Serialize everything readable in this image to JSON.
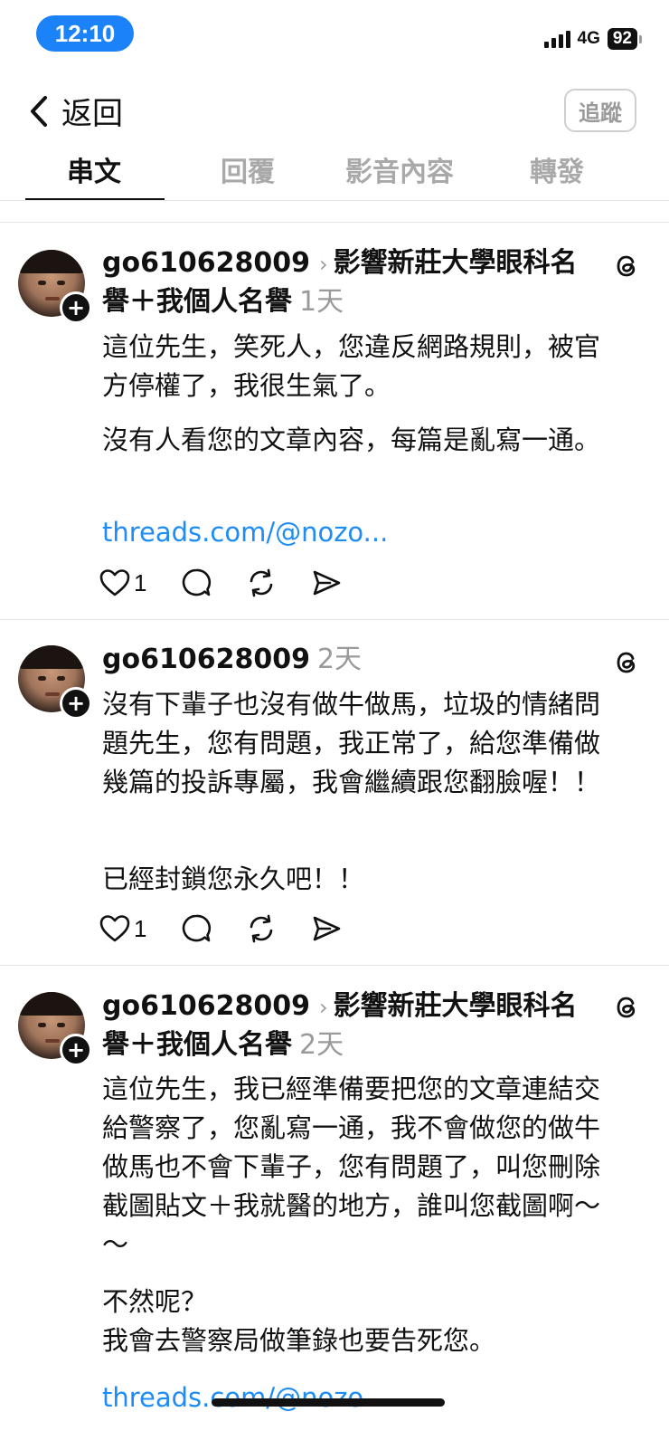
{
  "status_bar": {
    "time": "12:10",
    "network": "4G",
    "battery": "92"
  },
  "header": {
    "back_label": "返回",
    "follow_label": "追蹤"
  },
  "tabs": [
    {
      "label": "串文",
      "active": true
    },
    {
      "label": "回覆",
      "active": false
    },
    {
      "label": "影音內容",
      "active": false
    },
    {
      "label": "轉發",
      "active": false
    }
  ],
  "posts": [
    {
      "username": "go610628009",
      "topic": "影響新莊大學眼科名譽＋我個人名譽",
      "time": "1天",
      "paragraphs": [
        "這位先生，笑死人，您違反網路規則，被官方停權了，我很生氣了。",
        "沒有人看您的文章內容，每篇是亂寫一通。"
      ],
      "link": "threads.com/@nozo...",
      "likes": "1"
    },
    {
      "username": "go610628009",
      "topic": "",
      "time": "2天",
      "paragraphs": [
        "沒有下輩子也沒有做牛做馬，垃圾的情緒問題先生，您有問題，我正常了，給您準備做幾篇的投訴專屬，我會繼續跟您翻臉喔！！",
        "已經封鎖您永久吧！！"
      ],
      "link": "",
      "likes": "1"
    },
    {
      "username": "go610628009",
      "topic": "影響新莊大學眼科名譽＋我個人名譽",
      "time": "2天",
      "paragraphs": [
        "這位先生，我已經準備要把您的文章連結交給警察了，您亂寫一通，我不會做您的做牛做馬也不會下輩子，您有問題了，叫您刪除截圖貼文＋我就醫的地方，誰叫您截圖啊～～",
        "不然呢？\n我會去警察局做筆錄也要告死您。"
      ],
      "link": "threads.com/@nozo...",
      "likes": ""
    }
  ],
  "icons": {
    "back": "chevron-left-icon",
    "like": "heart-icon",
    "reply": "comment-icon",
    "repost": "repost-icon",
    "share": "send-icon",
    "threads": "threads-logo-icon",
    "follow_badge": "plus-icon"
  },
  "colors": {
    "link": "#1d8cf5",
    "time_pill": "#1b82f7",
    "muted": "#9a9a9a"
  }
}
